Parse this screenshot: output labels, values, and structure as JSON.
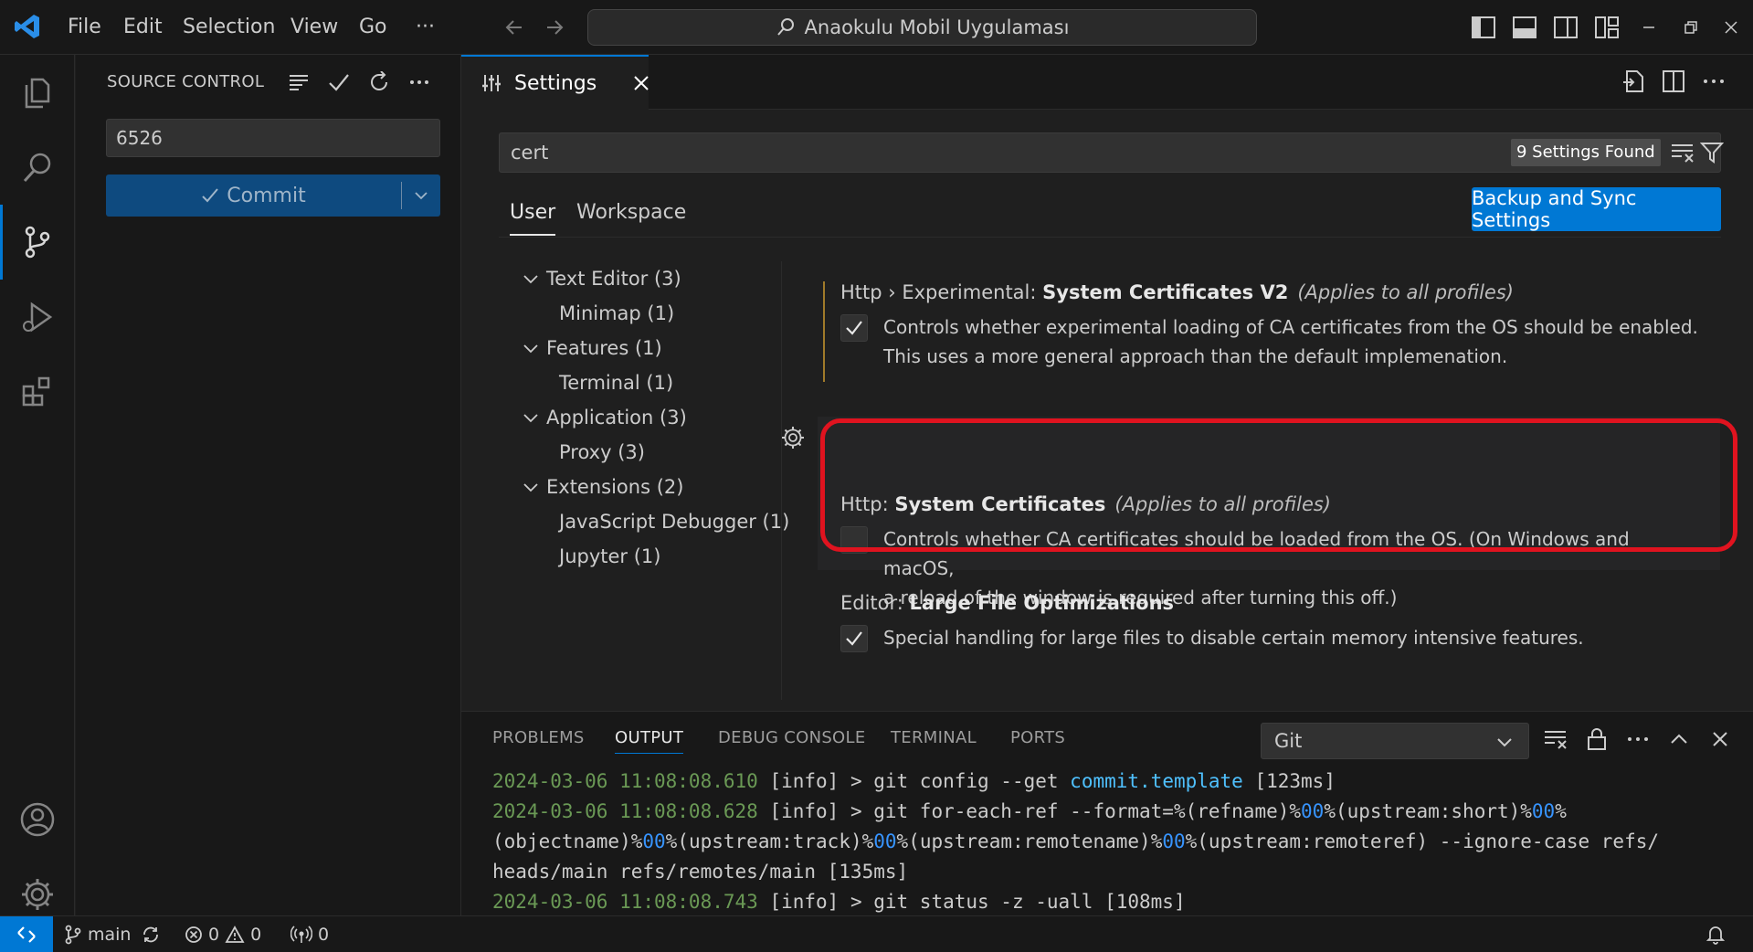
{
  "menu": {
    "file": "File",
    "edit": "Edit",
    "selection": "Selection",
    "view": "View",
    "go": "Go",
    "more": "···"
  },
  "command_center": {
    "title": "Anaokulu Mobil Uygulaması"
  },
  "source_control": {
    "title": "SOURCE CONTROL",
    "message_value": "6526",
    "commit_label": "Commit"
  },
  "tab": {
    "label": "Settings"
  },
  "settings": {
    "search_value": "cert",
    "found": "9 Settings Found",
    "scope_user": "User",
    "scope_workspace": "Workspace",
    "sync_button": "Backup and Sync Settings",
    "toc": [
      {
        "label": "Text Editor (3)"
      },
      {
        "label": "Minimap (1)"
      },
      {
        "label": "Features (1)"
      },
      {
        "label": "Terminal (1)"
      },
      {
        "label": "Application (3)"
      },
      {
        "label": "Proxy (3)"
      },
      {
        "label": "Extensions (2)"
      },
      {
        "label": "JavaScript Debugger (1)"
      },
      {
        "label": "Jupyter (1)"
      }
    ],
    "items": [
      {
        "category": "Http › Experimental: ",
        "name": "System Certificates V2",
        "scope": "(Applies to all profiles)",
        "desc1": "Controls whether experimental loading of CA certificates from the OS should be enabled.",
        "desc2": "This uses a more general approach than the default implemenation.",
        "checked": true
      },
      {
        "category": "Http: ",
        "name": "System Certificates",
        "scope": "(Applies to all profiles)",
        "desc1": "Controls whether CA certificates should be loaded from the OS. (On Windows and macOS,",
        "desc2": "a reload of the window is required after turning this off.)",
        "checked": false
      },
      {
        "category": "Editor: ",
        "name": "Large File Optimizations",
        "desc1": "Special handling for large files to disable certain memory intensive features.",
        "checked": true
      }
    ]
  },
  "panel": {
    "tabs": {
      "problems": "PROBLEMS",
      "output": "OUTPUT",
      "debug": "DEBUG CONSOLE",
      "terminal": "TERMINAL",
      "ports": "PORTS"
    },
    "channel": "Git",
    "log": [
      {
        "ts": "2024-03-06 11:08:08.610",
        "level": " [info] > git config --get ",
        "hl": "commit.template",
        "rest": " [123ms]"
      },
      {
        "ts": "2024-03-06 11:08:08.628",
        "level": " [info] > git for-each-ref --format=%(refname)%",
        "d1": "00",
        "m1": "%(upstream:short)%",
        "d2": "00",
        "m2": "%"
      },
      {
        "l2a": "(objectname)%",
        "d3": "00",
        "l2b": "%(upstream:track)%",
        "d4": "00",
        "l2c": "%(upstream:remotename)%",
        "d5": "00",
        "l2d": "%(upstream:remoteref) --ignore-case refs/"
      },
      {
        "l3": "heads/main refs/remotes/main [135ms]"
      },
      {
        "ts": "2024-03-06 11:08:08.743",
        "level": " [info] > git status -z -uall [108ms]"
      }
    ]
  },
  "status": {
    "branch": "main",
    "errors": "0",
    "warnings": "0",
    "ports": "0"
  },
  "colors": {
    "accent": "#0078d4",
    "highlight": "#e0131f",
    "background": "#1f1f1f"
  }
}
